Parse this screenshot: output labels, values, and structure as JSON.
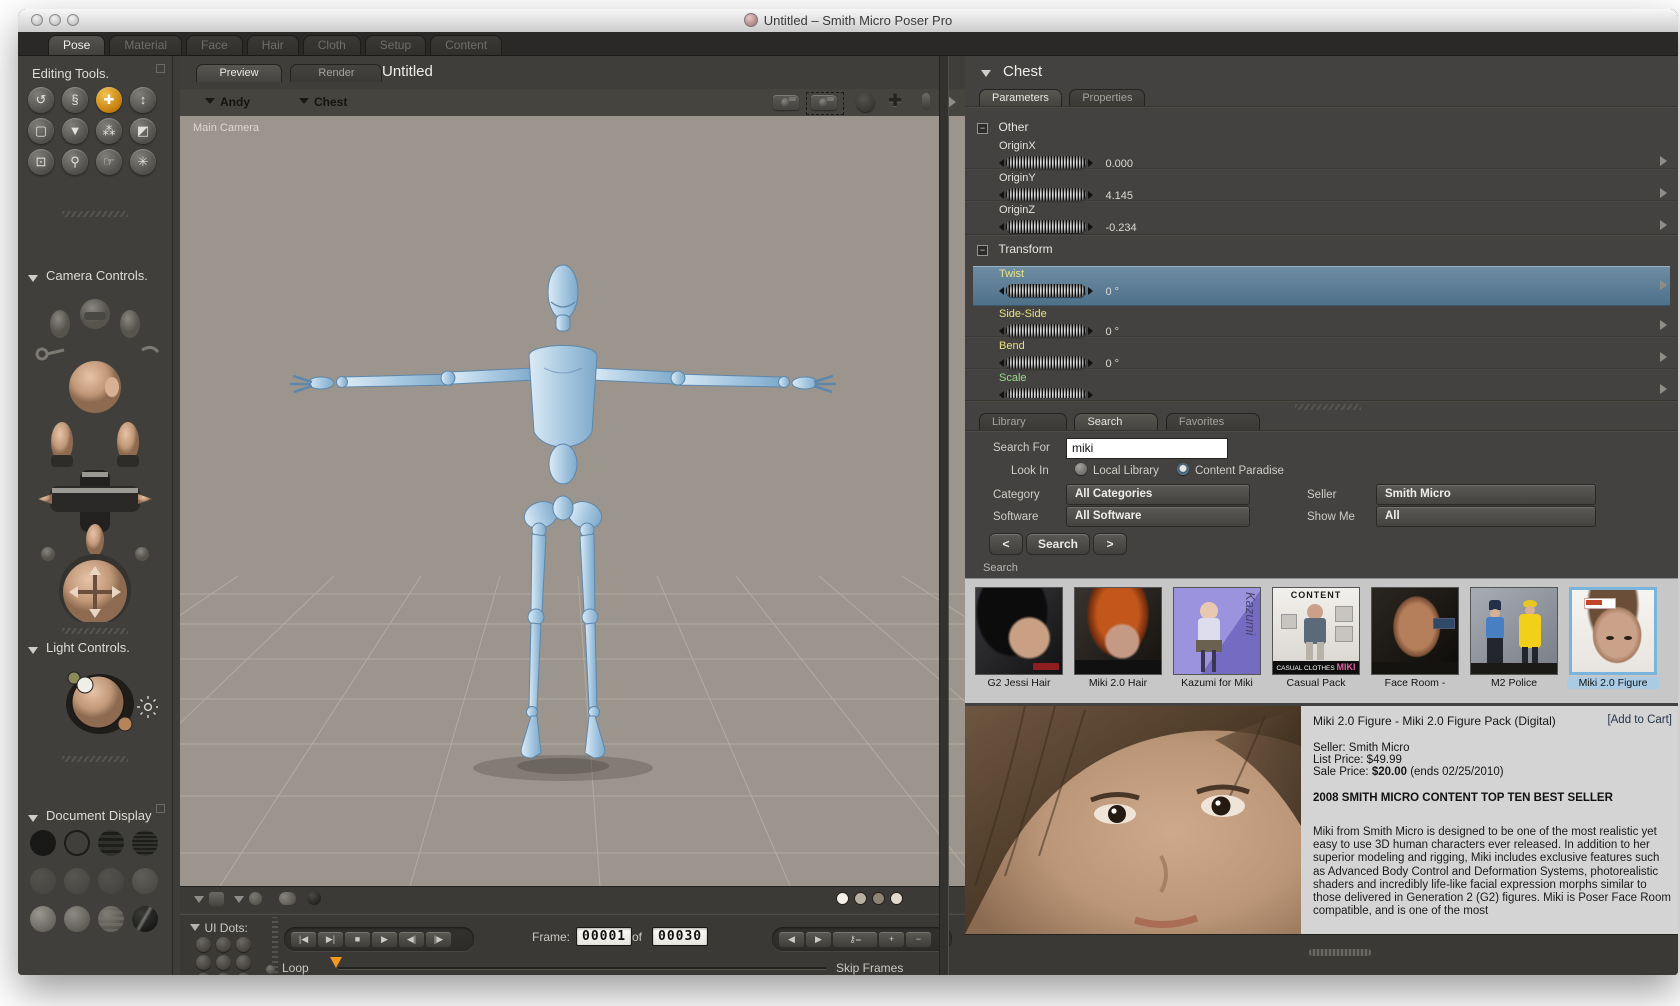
{
  "window": {
    "title": "Untitled – Smith Micro Poser Pro",
    "main_tabs": [
      {
        "label": "Pose",
        "active": true
      },
      {
        "label": "Material",
        "active": false
      },
      {
        "label": "Face",
        "active": false
      },
      {
        "label": "Hair",
        "active": false
      },
      {
        "label": "Cloth",
        "active": false
      },
      {
        "label": "Setup",
        "active": false
      },
      {
        "label": "Content",
        "active": false
      }
    ]
  },
  "sidebar": {
    "editing_tools_label": "Editing Tools.",
    "camera_controls_label": "Camera Controls.",
    "light_controls_label": "Light Controls.",
    "document_display_label": "Document Display"
  },
  "document": {
    "preview_tab": "Preview",
    "render_tab": "Render",
    "doc_title": "Untitled",
    "figure_menu": "Andy",
    "actor_menu": "Chest",
    "camera_label": "Main Camera"
  },
  "animation": {
    "ui_dots_label": "UI Dots:",
    "frame_label": "Frame:",
    "frame_current": "00001",
    "of_label": "of",
    "frame_total": "00030",
    "loop_label": "Loop",
    "skip_frames_label": "Skip Frames"
  },
  "parameters_panel": {
    "actor": "Chest",
    "tabs": [
      "Parameters",
      "Properties"
    ],
    "groups": [
      {
        "name": "Other",
        "params": [
          {
            "label": "OriginX",
            "value": "0.000"
          },
          {
            "label": "OriginY",
            "value": "4.145"
          },
          {
            "label": "OriginZ",
            "value": "-0.234"
          }
        ]
      },
      {
        "name": "Transform",
        "params": [
          {
            "label": "Twist",
            "value": "0 °",
            "selected": true
          },
          {
            "label": "Side-Side",
            "value": "0 °"
          },
          {
            "label": "Bend",
            "value": "0 °"
          },
          {
            "label": "Scale",
            "value": ""
          }
        ]
      }
    ],
    "highlight_color": "#4e7089",
    "rotation_label_color": "#e9e380",
    "scale_label_color": "#97da8d"
  },
  "library_panel": {
    "tabs": [
      "Library",
      "Search",
      "Favorites"
    ],
    "active_tab": "Search",
    "search_for_label": "Search For",
    "search_value": "miki",
    "look_in_label": "Look In",
    "radio_local": "Local Library",
    "radio_paradise": "Content Paradise",
    "selected_radio": "Content Paradise",
    "category_label": "Category",
    "category_value": "All Categories",
    "seller_label": "Seller",
    "seller_value": "Smith Micro",
    "software_label": "Software",
    "software_value": "All Software",
    "show_me_label": "Show Me",
    "show_me_value": "All",
    "prev_button": "<",
    "search_button": "Search",
    "next_button": ">",
    "results_label": "Search",
    "results": [
      {
        "label": "G2 Jessi Hair",
        "selected": false
      },
      {
        "label": "Miki 2.0 Hair",
        "selected": false
      },
      {
        "label": "Kazumi for Miki",
        "selected": false,
        "art_text": "Kazumi"
      },
      {
        "label": "Casual Pack",
        "selected": false,
        "art_text_top": "CONTENT",
        "art_text_bottom": "CASUAL CLOTHES",
        "art_text_pink": "MIKI"
      },
      {
        "label": "Face Room -",
        "selected": false
      },
      {
        "label": "M2 Police",
        "selected": false
      },
      {
        "label": "Miki 2.0 Figure",
        "selected": true
      }
    ]
  },
  "product": {
    "title": "Miki 2.0 Figure - Miki 2.0 Figure Pack (Digital)",
    "add_to_cart": "[Add to Cart]",
    "seller": "Seller: Smith Micro",
    "list_price": "List Price: $49.99",
    "sale_price_label": "Sale Price: ",
    "sale_price_value": "$20.00",
    "sale_price_suffix": " (ends 02/25/2010)",
    "badge": "2008 SMITH MICRO CONTENT TOP TEN BEST SELLER",
    "description": "Miki from Smith Micro is designed to be one of the most realistic yet easy to use 3D human characters ever released. In addition to her superior modeling and rigging, Miki includes exclusive features such as Advanced Body Control and Deformation Systems, photorealistic shaders and incredibly life-like facial expression morphs similar to those delivered in Generation 2 (G2) figures. Miki is Poser Face Room compatible, and is one of the most"
  }
}
